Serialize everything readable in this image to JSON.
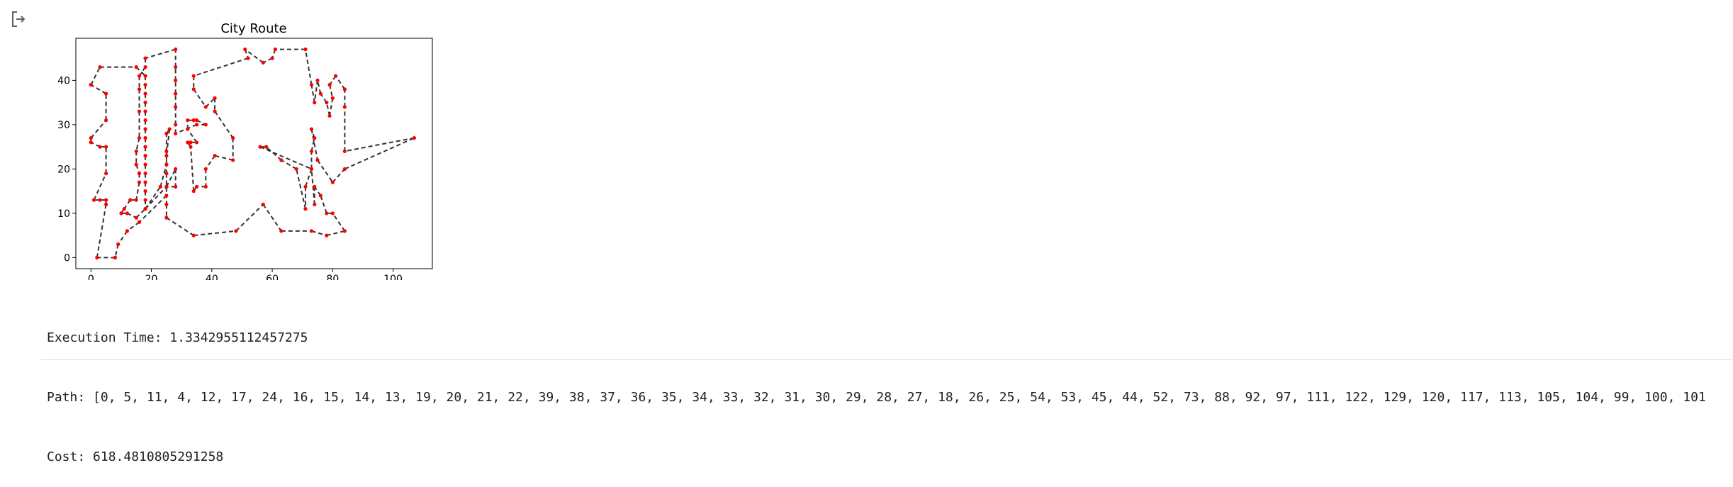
{
  "output": {
    "icon": "output-redirect-icon",
    "execution_time": "Execution Time: 1.3342955112457275",
    "path": "Path: [0, 5, 11, 4, 12, 17, 24, 16, 15, 14, 13, 19, 20, 21, 22, 39, 38, 37, 36, 35, 34, 33, 32, 31, 30, 29, 28, 27, 18, 26, 25, 54, 53, 45, 44, 52, 73, 88, 92, 97, 111, 122, 129, 120, 117, 113, 105, 104, 99, 100, 101",
    "cost": "Cost: 618.4810805291258"
  },
  "chart_data": {
    "type": "line",
    "title": "City Route",
    "xlabel": "",
    "ylabel": "",
    "xlim": [
      -5,
      113
    ],
    "ylim": [
      -2.5,
      49.5
    ],
    "xticks": [
      0,
      20,
      40,
      60,
      80,
      100
    ],
    "yticks": [
      0,
      10,
      20,
      30,
      40
    ],
    "line_color": "#333333",
    "line_style": "dashed",
    "marker_color": "#ff0000",
    "route": [
      [
        0,
        39
      ],
      [
        3,
        43
      ],
      [
        15,
        43
      ],
      [
        18,
        41
      ],
      [
        18,
        39
      ],
      [
        18,
        37
      ],
      [
        18,
        35
      ],
      [
        18,
        33
      ],
      [
        18,
        31
      ],
      [
        18,
        29
      ],
      [
        18,
        27
      ],
      [
        18,
        25
      ],
      [
        18,
        23
      ],
      [
        18,
        21
      ],
      [
        18,
        19
      ],
      [
        18,
        17
      ],
      [
        18,
        15
      ],
      [
        18,
        13
      ],
      [
        18,
        11
      ],
      [
        25,
        16
      ],
      [
        28,
        20
      ],
      [
        28,
        16
      ],
      [
        25,
        16
      ],
      [
        25,
        12
      ],
      [
        25,
        9
      ],
      [
        34,
        5
      ],
      [
        48,
        6
      ],
      [
        57,
        12
      ],
      [
        63,
        6
      ],
      [
        73,
        6
      ],
      [
        78,
        5
      ],
      [
        84,
        6
      ],
      [
        80,
        10
      ],
      [
        78,
        10
      ],
      [
        76,
        14
      ],
      [
        74,
        16
      ],
      [
        74,
        12
      ],
      [
        73,
        20
      ],
      [
        71,
        16
      ],
      [
        71,
        11
      ],
      [
        68,
        20
      ],
      [
        63,
        22
      ],
      [
        58,
        25
      ],
      [
        56,
        25
      ],
      [
        73,
        20
      ],
      [
        73,
        24
      ],
      [
        74,
        27
      ],
      [
        73,
        29
      ],
      [
        75,
        22
      ],
      [
        80,
        17
      ],
      [
        84,
        20
      ],
      [
        107,
        27
      ],
      [
        84,
        24
      ],
      [
        84,
        34
      ],
      [
        84,
        38
      ],
      [
        81,
        41
      ],
      [
        79,
        39
      ],
      [
        80,
        36
      ],
      [
        79,
        32
      ],
      [
        78,
        35
      ],
      [
        76,
        37
      ],
      [
        75,
        40
      ],
      [
        74,
        35
      ],
      [
        73,
        39
      ],
      [
        71,
        47
      ],
      [
        61,
        47
      ],
      [
        60,
        45
      ],
      [
        57,
        44
      ],
      [
        51,
        47
      ],
      [
        52,
        45
      ],
      [
        34,
        41
      ],
      [
        34,
        38
      ],
      [
        38,
        34
      ],
      [
        41,
        36
      ],
      [
        41,
        33
      ],
      [
        47,
        27
      ],
      [
        47,
        22
      ],
      [
        41,
        23
      ],
      [
        38,
        20
      ],
      [
        38,
        16
      ],
      [
        35,
        16
      ],
      [
        34,
        15
      ],
      [
        33,
        25
      ],
      [
        32,
        26
      ],
      [
        33,
        26
      ],
      [
        35,
        26
      ],
      [
        32,
        29
      ],
      [
        32,
        31
      ],
      [
        34,
        31
      ],
      [
        35,
        31
      ],
      [
        38,
        30
      ],
      [
        35,
        30
      ],
      [
        28,
        28
      ],
      [
        28,
        30
      ],
      [
        28,
        34
      ],
      [
        28,
        37
      ],
      [
        28,
        40
      ],
      [
        28,
        43
      ],
      [
        28,
        47
      ],
      [
        18,
        45
      ],
      [
        18,
        43
      ],
      [
        16,
        41
      ],
      [
        16,
        38
      ],
      [
        16,
        33
      ],
      [
        16,
        27
      ],
      [
        15,
        24
      ],
      [
        15,
        21
      ],
      [
        16,
        19
      ],
      [
        16,
        17
      ],
      [
        15,
        13
      ],
      [
        13,
        13
      ],
      [
        11,
        11
      ],
      [
        10,
        10
      ],
      [
        12,
        10
      ],
      [
        15,
        9
      ],
      [
        18,
        11
      ],
      [
        23,
        16
      ],
      [
        25,
        21
      ],
      [
        25,
        24
      ],
      [
        25,
        28
      ],
      [
        26,
        29
      ],
      [
        25,
        23
      ],
      [
        25,
        19
      ],
      [
        25,
        14
      ],
      [
        16,
        8
      ],
      [
        12,
        6
      ],
      [
        9,
        3
      ],
      [
        8,
        0
      ],
      [
        2,
        0
      ],
      [
        5,
        12
      ],
      [
        5,
        13
      ],
      [
        3,
        13
      ],
      [
        1,
        13
      ],
      [
        5,
        19
      ],
      [
        5,
        25
      ],
      [
        3,
        25
      ],
      [
        0,
        26
      ],
      [
        0,
        27
      ],
      [
        5,
        31
      ],
      [
        5,
        37
      ],
      [
        0,
        39
      ]
    ]
  }
}
